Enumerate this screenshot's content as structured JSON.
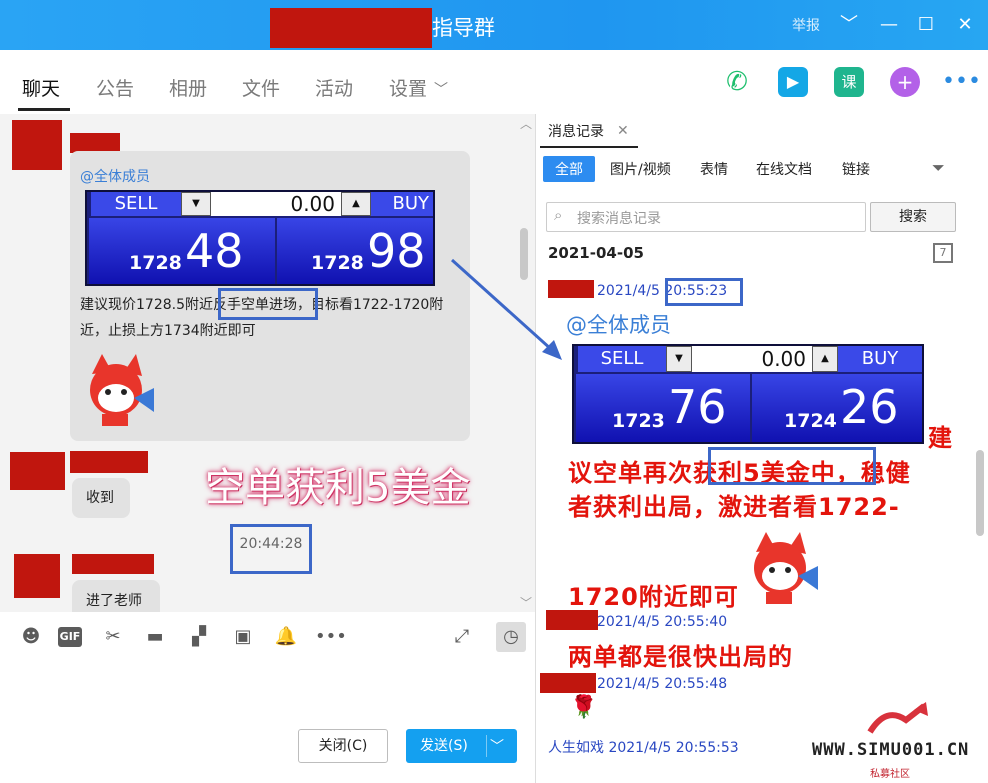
{
  "title": {
    "group_name": "指导群",
    "report": "举报"
  },
  "tabs": [
    "聊天",
    "公告",
    "相册",
    "文件",
    "活动",
    "设置"
  ],
  "chat": {
    "mention": "@全体成员",
    "trade_left": {
      "sell": "SELL",
      "buy": "BUY",
      "price": "0.00",
      "sell_small": "1728",
      "sell_large": "48",
      "buy_small": "1728",
      "buy_large": "98"
    },
    "message": "建议现价1728.5附近反手空单进场，目标看1722-1720附近，止损上方1734附近即可",
    "reply1": "收到",
    "overlay": "空单获利5美金",
    "time": "20:44:28",
    "reply2": "进了老师"
  },
  "input": {
    "close": "关闭(C)",
    "send": "发送(S)"
  },
  "history": {
    "tab": "消息记录",
    "filters": [
      "全部",
      "图片/视频",
      "表情",
      "在线文档",
      "链接"
    ],
    "search_placeholder": "搜索消息记录",
    "search_btn": "搜索",
    "date": "2021-04-05",
    "ts1": "2021/4/5 20:55:23",
    "mention": "@全体成员",
    "trade_right": {
      "sell": "SELL",
      "buy": "BUY",
      "price": "0.00",
      "sell_small": "1723",
      "sell_large": "76",
      "buy_small": "1724",
      "buy_large": "26"
    },
    "red1": "建",
    "red2": "议空单再次获利5美金中，稳健",
    "red3": "者获利出局，激进者看1722-",
    "red4": "1720附近即可",
    "ts2": "2021/4/5 20:55:40",
    "red5": "两单都是很快出局的",
    "ts3": "2021/4/5 20:55:48",
    "ts4": "人生如戏 2021/4/5 20:55:53"
  },
  "watermark": {
    "main": "WWW.SIMU001.CN",
    "sub": "私募社区"
  }
}
